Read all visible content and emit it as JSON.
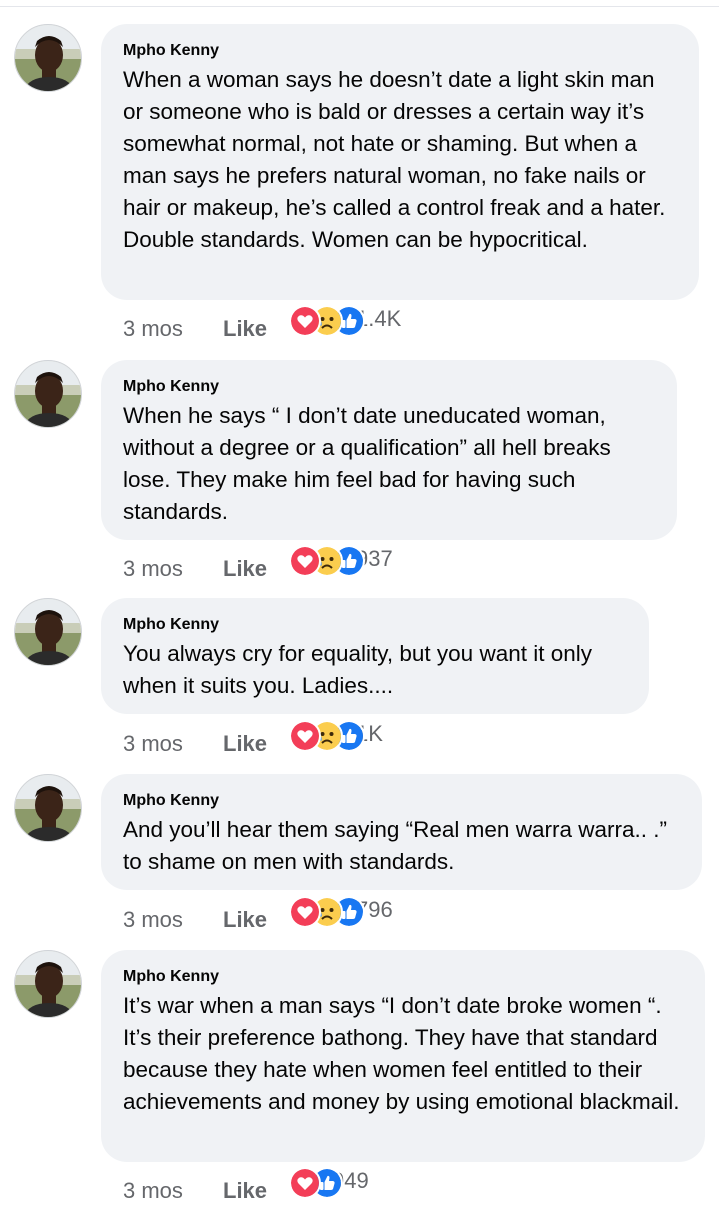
{
  "comments": [
    {
      "author": "Mpho Kenny",
      "text": "When a woman says he doesn’t date a light skin man or someone who is bald or dresses a certain way it’s somewhat normal, not hate or shaming. But when a man says he prefers natural woman, no fake nails or hair or makeup, he’s called a control freak and a hater. Double standards. Women can be hypocritical.",
      "time": "3 mos",
      "like_label": "Like",
      "reactions": [
        "love-icon",
        "sad-icon",
        "like-icon"
      ],
      "count": "1.4K"
    },
    {
      "author": "Mpho Kenny",
      "text": "When he says “ I don’t date uneducated woman, without a degree or a qualification” all hell breaks lose. They make him feel bad for having such standards.",
      "time": "3 mos",
      "like_label": "Like",
      "reactions": [
        "love-icon",
        "sad-icon",
        "like-icon"
      ],
      "count": "937"
    },
    {
      "author": "Mpho Kenny",
      "text": "You always cry for equality, but you want it only when it suits you. Ladies....",
      "time": "3 mos",
      "like_label": "Like",
      "reactions": [
        "love-icon",
        "sad-icon",
        "like-icon"
      ],
      "count": "1K"
    },
    {
      "author": "Mpho Kenny",
      "text": "And you’ll hear them saying “Real men warra warra.. .” to shame on men with standards.",
      "time": "3 mos",
      "like_label": "Like",
      "reactions": [
        "love-icon",
        "sad-icon",
        "like-icon"
      ],
      "count": "796"
    },
    {
      "author": "Mpho Kenny",
      "text": "It’s war when a man says “I don’t date broke women “. It’s their preference bathong. They have that standard because they hate when women feel entitled to their achievements and money  by using emotional blackmail.",
      "time": "3 mos",
      "like_label": "Like",
      "reactions": [
        "love-icon",
        "like-icon"
      ],
      "count": "949"
    }
  ],
  "colors": {
    "bubble": "#f0f2f5",
    "meta_text": "#65676b",
    "love": "#f33e58",
    "sad": "#fbcd4e",
    "like": "#1877f2"
  }
}
